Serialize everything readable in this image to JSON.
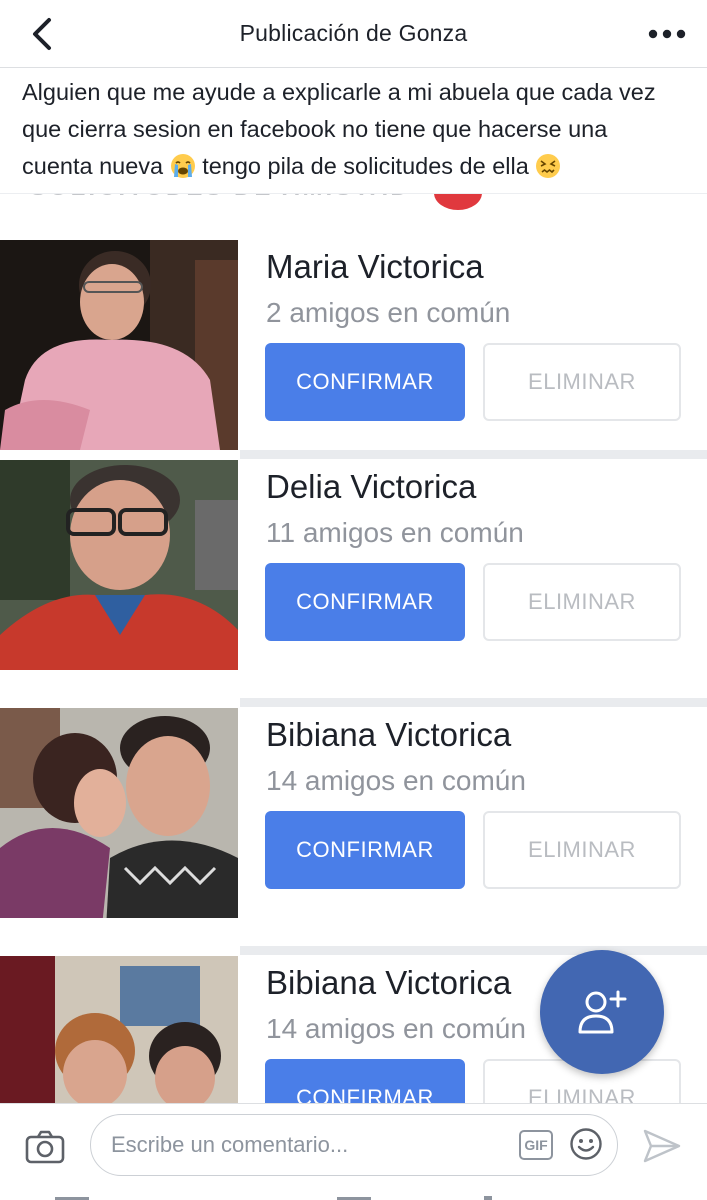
{
  "header": {
    "title": "Publicación de Gonza",
    "back_icon": "chevron-left-icon",
    "more_icon": "more-dots-icon"
  },
  "post": {
    "line1": "Alguien que me ayude a explicarle a mi abuela que cada vez",
    "line2": "que cierra sesion en facebook no tiene que hacerse una",
    "line3a": "cuenta nueva",
    "line3b": "tengo pila de solicitudes de ella",
    "emoji1": "crying-face-emoji",
    "emoji2": "confounded-face-emoji"
  },
  "requests": [
    {
      "name": "Maria Victorica",
      "mutual": "2 amigos en común",
      "confirm": "CONFIRMAR",
      "delete": "ELIMINAR"
    },
    {
      "name": "Delia Victorica",
      "mutual": "11 amigos en común",
      "confirm": "CONFIRMAR",
      "delete": "ELIMINAR"
    },
    {
      "name": "Bibiana Victorica",
      "mutual": "14 amigos en común",
      "confirm": "CONFIRMAR",
      "delete": "ELIMINAR"
    },
    {
      "name": "Bibiana Victorica",
      "mutual": "14 amigos en común",
      "confirm": "CONFIRMAR",
      "delete": "ELIMINAR"
    }
  ],
  "fab": {
    "icon": "add-friend-icon"
  },
  "comment_bar": {
    "placeholder": "Escribe un comentario...",
    "gif_label": "GIF",
    "camera_icon": "camera-icon",
    "smile_icon": "smile-icon",
    "send_icon": "send-icon"
  },
  "colors": {
    "confirm_blue": "#4a7ee8",
    "fab_blue": "#4267b2",
    "muted_gray": "#90949c"
  }
}
